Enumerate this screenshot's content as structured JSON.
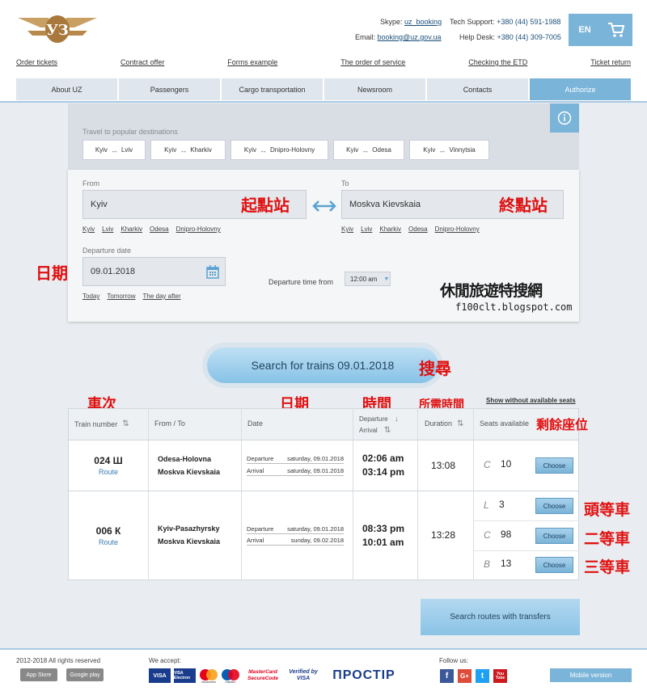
{
  "header": {
    "skype_label": "Skype:",
    "skype": "uz_booking",
    "support_label": "Tech Support:",
    "support": "+380 (44) 591-1988",
    "email_label": "Email:",
    "email": "booking@uz.gov.ua",
    "helpdesk_label": "Help Desk:",
    "helpdesk": "+380 (44) 309-7005",
    "lang": "EN"
  },
  "toplinks": [
    "Order tickets",
    "Contract offer",
    "Forms example",
    "The order of service",
    "Checking the ETD",
    "Ticket return"
  ],
  "nav": [
    "About UZ",
    "Passengers",
    "Cargo transportation",
    "Newsroom",
    "Contacts",
    "Authorize"
  ],
  "popular": {
    "title": "Travel to popular destinations",
    "chips": [
      {
        "from": "Kyiv",
        "to": "Lviv"
      },
      {
        "from": "Kyiv",
        "to": "Kharkiv"
      },
      {
        "from": "Kyiv",
        "to": "Dnipro-Holovny"
      },
      {
        "from": "Kyiv",
        "to": "Odesa"
      },
      {
        "from": "Kyiv",
        "to": "Vinnytsia"
      }
    ]
  },
  "form": {
    "from_label": "From",
    "from_value": "Kyiv",
    "to_label": "To",
    "to_value": "Moskva Kievskaia",
    "suggestions": [
      "Kyiv",
      "Lviv",
      "Kharkiv",
      "Odesa",
      "Dnipro-Holovny"
    ],
    "date_label": "Departure date",
    "date_value": "09.01.2018",
    "date_links": [
      "Today",
      "Tomorrow",
      "The day after"
    ],
    "time_label": "Departure time from",
    "time_value": "12:00 am",
    "search_button": "Search for trains 09.01.2018"
  },
  "annotations": {
    "origin": "起點站",
    "destination": "終點站",
    "date": "日期",
    "search": "搜尋",
    "train_no": "車次",
    "date2": "日期",
    "time": "時間",
    "duration": "所需時間",
    "seats": "剩餘座位",
    "first_class": "頭等車",
    "second_class": "二等車",
    "third_class": "三等車",
    "watermark_cn": "休閒旅遊特搜網",
    "watermark_url": "f100clt.blogspot.com"
  },
  "table": {
    "show_without": "Show without available seats",
    "headers": {
      "train": "Train number",
      "fromto": "From / To",
      "date": "Date",
      "departure": "Departure",
      "arrival": "Arrival",
      "duration": "Duration",
      "seats": "Seats available"
    },
    "rows": [
      {
        "number": "024 Ш",
        "route": "Route",
        "from": "Odesa-Holovna",
        "to": "Moskva Kievskaia",
        "dep_label": "Departure",
        "dep_date": "saturday, 09.01.2018",
        "arr_label": "Arrival",
        "arr_date": "saturday, 09.01.2018",
        "dep_time": "02:06 am",
        "arr_time": "03:14 pm",
        "duration": "13:08",
        "seats": [
          {
            "cls": "C",
            "n": "10",
            "btn": "Choose"
          }
        ]
      },
      {
        "number": "006 К",
        "route": "Route",
        "from": "Kyiv-Pasazhyrsky",
        "to": "Moskva Kievskaia",
        "dep_label": "Departure",
        "dep_date": "saturday, 09.01.2018",
        "arr_label": "Arrival",
        "arr_date": "sunday, 09.02.2018",
        "dep_time": "08:33 pm",
        "arr_time": "10:01 am",
        "duration": "13:28",
        "seats": [
          {
            "cls": "L",
            "n": "3",
            "btn": "Choose"
          },
          {
            "cls": "C",
            "n": "98",
            "btn": "Choose"
          },
          {
            "cls": "B",
            "n": "13",
            "btn": "Choose"
          }
        ]
      }
    ],
    "transfers_button": "Search routes with transfers"
  },
  "footer": {
    "copyright": "2012-2018 All rights reserved",
    "accept": "We accept:",
    "appstore": "App Store",
    "googleplay": "Google play",
    "pay": [
      "VISA",
      "VISA Electron",
      "mastercard",
      "maestro",
      "MasterCard SecureCode",
      "Verified by VISA",
      "ПРОСТІР"
    ],
    "follow": "Follow us:",
    "social": [
      "f",
      "G+",
      "t",
      "You Tube"
    ],
    "mobile": "Mobile version"
  },
  "colors": {
    "accent": "#7ab4d8",
    "annotation": "#e01010",
    "nav": "#dfe6ee"
  },
  "icons": [
    "uz-logo",
    "cart-icon",
    "info-icon",
    "swap-icon",
    "calendar-icon",
    "sort-icon",
    "chevron-down-icon"
  ]
}
